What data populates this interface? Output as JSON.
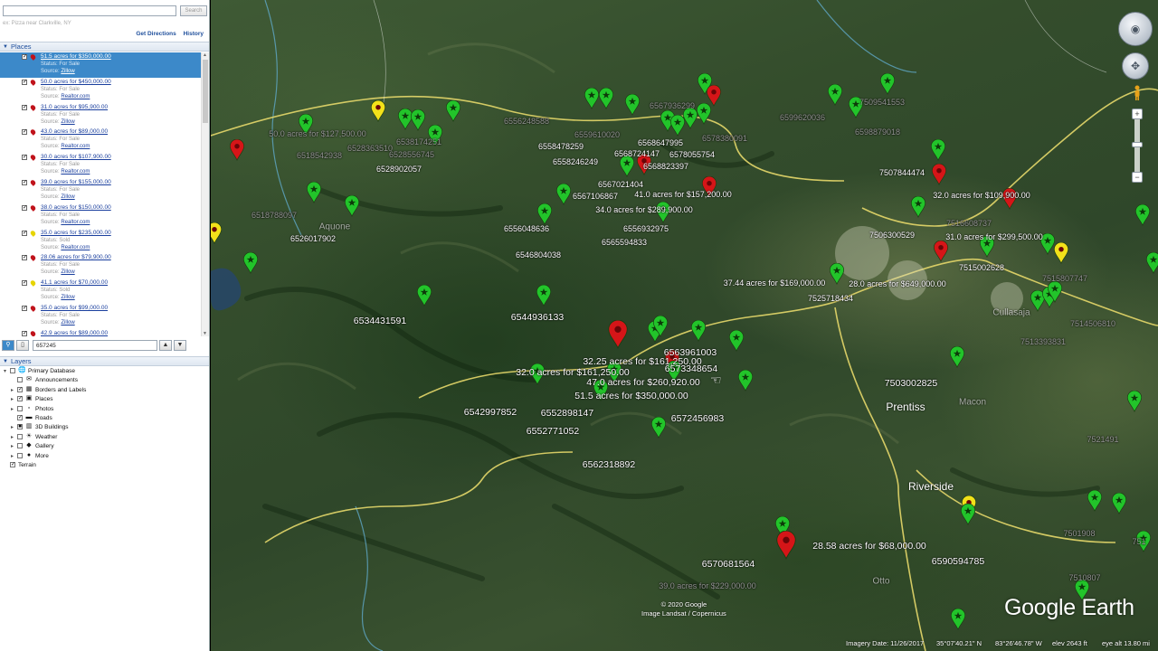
{
  "search": {
    "value": "",
    "placeholder": "",
    "button_label": "Search",
    "hint": "ex: Pizza near Clarkville, NY"
  },
  "directions": {
    "get_directions": "Get Directions",
    "history": "History"
  },
  "places": {
    "header": "Places",
    "items": [
      {
        "title": "51.5 acres for $350,000.00",
        "status": "Status: For Sale",
        "source_prefix": "Source: ",
        "source": "Zillow",
        "color": "#c0131b",
        "selected": true
      },
      {
        "title": "50.0 acres for $450,000.00",
        "status": "Status: For Sale",
        "source_prefix": "Source: ",
        "source": "Realtor.com",
        "color": "#c0131b"
      },
      {
        "title": "31.0 acres for $95,900.00",
        "status": "Status: For Sale",
        "source_prefix": "Source: ",
        "source": "Zillow",
        "color": "#c0131b"
      },
      {
        "title": "43.0 acres for $89,000.00",
        "status": "Status: For Sale",
        "source_prefix": "Source: ",
        "source": "Realtor.com",
        "color": "#c0131b"
      },
      {
        "title": "30.0 acres for $107,900.00",
        "status": "Status: For Sale",
        "source_prefix": "Source: ",
        "source": "Realtor.com",
        "color": "#c0131b"
      },
      {
        "title": "39.0 acres for $155,000.00",
        "status": "Status: For Sale",
        "source_prefix": "Source: ",
        "source": "Zillow",
        "color": "#c0131b"
      },
      {
        "title": "38.0 acres for $150,000.00",
        "status": "Status: For Sale",
        "source_prefix": "Source: ",
        "source": "Realtor.com",
        "color": "#c0131b"
      },
      {
        "title": "35.0 acres for $235,000.00",
        "status": "Status: Sold",
        "source_prefix": "Source: ",
        "source": "Realtor.com",
        "color": "#e6d400"
      },
      {
        "title": "28.06 acres for $79,900.00",
        "status": "Status: For Sale",
        "source_prefix": "Source: ",
        "source": "Zillow",
        "color": "#c0131b"
      },
      {
        "title": "41.1 acres for $70,000.00",
        "status": "Status: Sold",
        "source_prefix": "Source: ",
        "source": "Zillow",
        "color": "#e6d400"
      },
      {
        "title": "35.0 acres for $99,000.00",
        "status": "Status: For Sale",
        "source_prefix": "Source: ",
        "source": "Zillow",
        "color": "#c0131b"
      },
      {
        "title": "42.9 acres for $89,000.00",
        "status": "",
        "source_prefix": "",
        "source": "",
        "color": "#c0131b"
      }
    ]
  },
  "find": {
    "value": "657245"
  },
  "layers": {
    "header": "Layers",
    "items": [
      {
        "label": "Primary Database",
        "level": 0,
        "expand": "▾",
        "checked": "",
        "icon": "globe-icon",
        "glyph": "🌐"
      },
      {
        "label": "Announcements",
        "level": 1,
        "expand": "",
        "checked": "",
        "icon": "envelope-icon",
        "glyph": "✉"
      },
      {
        "label": "Borders and Labels",
        "level": 1,
        "expand": "▸",
        "checked": "✓",
        "icon": "border-icon",
        "glyph": "▦"
      },
      {
        "label": "Places",
        "level": 1,
        "expand": "▸",
        "checked": "✓",
        "icon": "places-icon",
        "glyph": "▣"
      },
      {
        "label": "Photos",
        "level": 1,
        "expand": "▸",
        "checked": "",
        "icon": "photo-icon",
        "glyph": "▫"
      },
      {
        "label": "Roads",
        "level": 1,
        "expand": "",
        "checked": "✓",
        "icon": "road-icon",
        "glyph": "▬"
      },
      {
        "label": "3D Buildings",
        "level": 1,
        "expand": "▸",
        "checked": "■",
        "icon": "building-icon",
        "glyph": "▥"
      },
      {
        "label": "Weather",
        "level": 1,
        "expand": "▸",
        "checked": "",
        "icon": "weather-icon",
        "glyph": "☀"
      },
      {
        "label": "Gallery",
        "level": 1,
        "expand": "▸",
        "checked": "",
        "icon": "gallery-icon",
        "glyph": "◆"
      },
      {
        "label": "More",
        "level": 1,
        "expand": "▸",
        "checked": "",
        "icon": "more-icon",
        "glyph": "●"
      },
      {
        "label": "Terrain",
        "level": 0,
        "expand": "",
        "checked": "✓",
        "icon": "",
        "glyph": ""
      }
    ]
  },
  "map": {
    "labels": [
      {
        "t": "50.0 acres for $127,500.00",
        "v": "dim"
      },
      {
        "t": "6528363510",
        "v": "dim"
      },
      {
        "t": "6518542938",
        "v": "dim"
      },
      {
        "t": "6538174251",
        "v": "dim"
      },
      {
        "t": "6528556745",
        "v": "dim"
      },
      {
        "t": "6528902057",
        "v": "small"
      },
      {
        "t": "6518788097",
        "v": "dim"
      },
      {
        "t": "6526017902",
        "v": "small"
      },
      {
        "t": "6556248588",
        "v": "dim"
      },
      {
        "t": "6559610020",
        "v": "dim"
      },
      {
        "t": "6558478259",
        "v": "small"
      },
      {
        "t": "6567936299",
        "v": "dim"
      },
      {
        "t": "6568647995",
        "v": "small"
      },
      {
        "t": "6568724147",
        "v": "small"
      },
      {
        "t": "6578055754",
        "v": "small"
      },
      {
        "t": "6578380091",
        "v": "dim"
      },
      {
        "t": "6568823397",
        "v": "small"
      },
      {
        "t": "6558246249",
        "v": "small"
      },
      {
        "t": "6567021404",
        "v": "small"
      },
      {
        "t": "6567106867",
        "v": "small"
      },
      {
        "t": "41.0 acres for $157,200.00",
        "v": "small"
      },
      {
        "t": "34.0 acres for $289,900.00",
        "v": "small"
      },
      {
        "t": "6556048636",
        "v": "small"
      },
      {
        "t": "6556932975",
        "v": "small"
      },
      {
        "t": "6565594833",
        "v": "small"
      },
      {
        "t": "6546804038",
        "v": "small"
      },
      {
        "t": "6599620036",
        "v": "dim"
      },
      {
        "t": "7509541553",
        "v": "dim"
      },
      {
        "t": "6598879018",
        "v": "dim"
      },
      {
        "t": "7507844474",
        "v": "small"
      },
      {
        "t": "32.0 acres for $109,900.00",
        "v": "small"
      },
      {
        "t": "7516608737",
        "v": "dim"
      },
      {
        "t": "7506300529",
        "v": "small"
      },
      {
        "t": "31.0 acres for $299,500.00",
        "v": "small"
      },
      {
        "t": "7515002628",
        "v": "small"
      },
      {
        "t": "7515807747",
        "v": "dim"
      },
      {
        "t": "37.44 acres for $169,000.00",
        "v": "small"
      },
      {
        "t": "28.0 acres for $649,000.00",
        "v": "small"
      },
      {
        "t": "7525718434",
        "v": "small"
      },
      {
        "t": "6534431591",
        "v": ""
      },
      {
        "t": "6544936133",
        "v": ""
      },
      {
        "t": "6563961003",
        "v": ""
      },
      {
        "t": "32.25 acres for $161,250.00",
        "v": ""
      },
      {
        "t": "32.0 acres for $161,250.00",
        "v": ""
      },
      {
        "t": "6573348654",
        "v": ""
      },
      {
        "t": "47.0 acres for $260,920.00",
        "v": ""
      },
      {
        "t": "51.5 acres for $350,000.00",
        "v": ""
      },
      {
        "t": "6542997852",
        "v": ""
      },
      {
        "t": "6552898147",
        "v": ""
      },
      {
        "t": "6572456983",
        "v": ""
      },
      {
        "t": "6552771052",
        "v": ""
      },
      {
        "t": "6562318892",
        "v": ""
      },
      {
        "t": "7503002825",
        "v": ""
      },
      {
        "t": "7514506810",
        "v": "dim"
      },
      {
        "t": "7513393831",
        "v": "dim"
      },
      {
        "t": "7521491",
        "v": "dim"
      },
      {
        "t": "28.58 acres for $68,000.00",
        "v": ""
      },
      {
        "t": "6570681564",
        "v": ""
      },
      {
        "t": "6590594785",
        "v": ""
      },
      {
        "t": "39.0 acres for $229,000.00",
        "v": "dim"
      },
      {
        "t": "7501908",
        "v": "dim"
      },
      {
        "t": "7510807",
        "v": "dim"
      },
      {
        "t": "751",
        "v": "dim"
      }
    ],
    "towns": [
      "Aquone",
      "Prentiss",
      "Riverside",
      "Cullasaja",
      "Macon",
      "Otto"
    ],
    "colors": {
      "green": "#22c42a",
      "red": "#d51518",
      "yellow": "#f3e11a"
    }
  },
  "attribution": {
    "line1": "© 2020 Google",
    "line2": "Image Landsat / Copernicus"
  },
  "logo": "Google Earth",
  "status_bar": {
    "imagery_date": "Imagery Date: 11/26/2017",
    "lat": "35°07'40.21\" N",
    "lon": "83°26'46.78\" W",
    "elev": "elev  2643 ft",
    "eye_alt": "eye alt  13.80 mi"
  }
}
